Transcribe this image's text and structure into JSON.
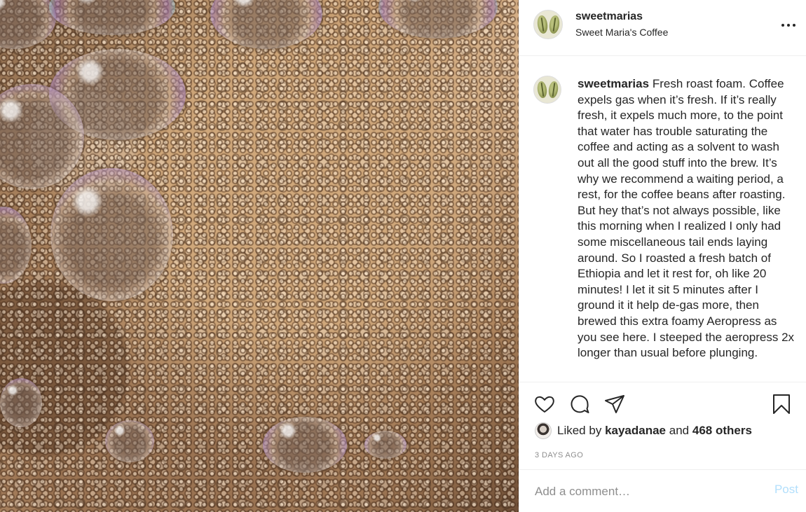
{
  "post": {
    "username": "sweetmarias",
    "display_name": "Sweet Maria's Coffee",
    "more_icon": "more-options-icon",
    "caption_username": "sweetmarias",
    "caption_text": "Fresh roast foam. Coffee expels gas when it’s fresh. If it’s really fresh, it expels much more, to the point that water has trouble saturating the coffee and acting as a solvent to wash out all the good stuff into the brew. It’s why we recommend a waiting period, a rest, for the coffee beans after roasting. But hey that’s not always possible, like this morning when I realized I only had some miscellaneous tail ends laying around. So I roasted a fresh batch of Ethiopia and let it rest for, oh like 20 minutes! I let it sit 5 minutes after I ground it it help de-gas more, then brewed this extra foamy Aeropress as you see here. I steeped the aeropress 2x longer than usual before plunging.",
    "photo_subject": "coffee foam bubbles close-up"
  },
  "actions": {
    "icons": [
      "heart-icon",
      "comment-icon",
      "share-icon",
      "bookmark-icon"
    ]
  },
  "likes": {
    "prefix": "Liked by",
    "first_user": "kayadanae",
    "joiner": "and",
    "others": "468 others"
  },
  "timestamp": "3 DAYS AGO",
  "comment_box": {
    "placeholder": "Add a comment…",
    "post_label": "Post"
  },
  "colors": {
    "text": "#262626",
    "muted": "#8e8e8e",
    "divider": "#efefef",
    "post_disabled": "#b2dffc"
  }
}
